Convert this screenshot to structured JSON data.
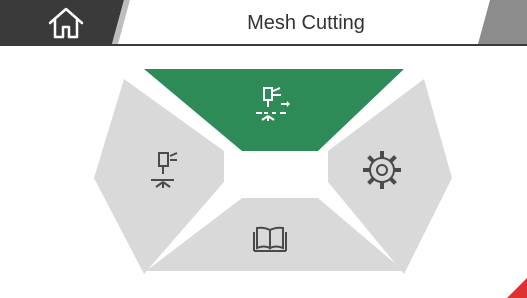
{
  "header": {
    "title": "Mesh Cutting",
    "home_icon": "home-icon",
    "back_icon": "back-chevron-icon"
  },
  "menu": {
    "items": [
      {
        "id": "laser-cutting",
        "icon": "laser-cutting-icon",
        "active": true
      },
      {
        "id": "laser-head",
        "icon": "laser-head-icon",
        "active": false
      },
      {
        "id": "settings",
        "icon": "gear-icon",
        "active": false
      },
      {
        "id": "manual",
        "icon": "book-icon",
        "active": false
      }
    ]
  },
  "colors": {
    "header_dark": "#3a3a3a",
    "active_segment": "#2e8b57",
    "inactive_segment": "#d9d9d9",
    "icon_on_gray": "#4a4a4a",
    "corner_accent": "#e03030"
  }
}
